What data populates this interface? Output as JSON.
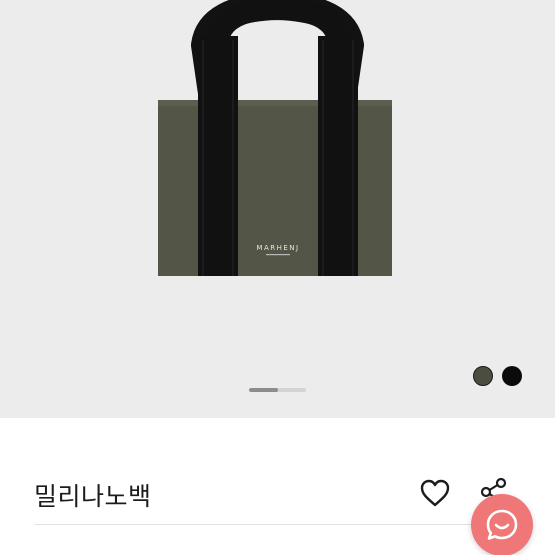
{
  "product": {
    "title": "밀리나노백",
    "brand_label": "MARHENJ"
  },
  "gallery": {
    "progress": 0.5
  },
  "color_options": [
    {
      "name": "khaki",
      "hex": "#4b4d41",
      "selected": true
    },
    {
      "name": "black",
      "hex": "#0b0b0b",
      "selected": false
    }
  ],
  "colors": {
    "hero_background": "#ececec",
    "bag_body": "#535546",
    "strap": "#111111",
    "chat_button": "#f07777"
  },
  "icons": {
    "wishlist": "heart-outline-icon",
    "share": "share-icon",
    "chat": "chat-bubble-icon"
  }
}
